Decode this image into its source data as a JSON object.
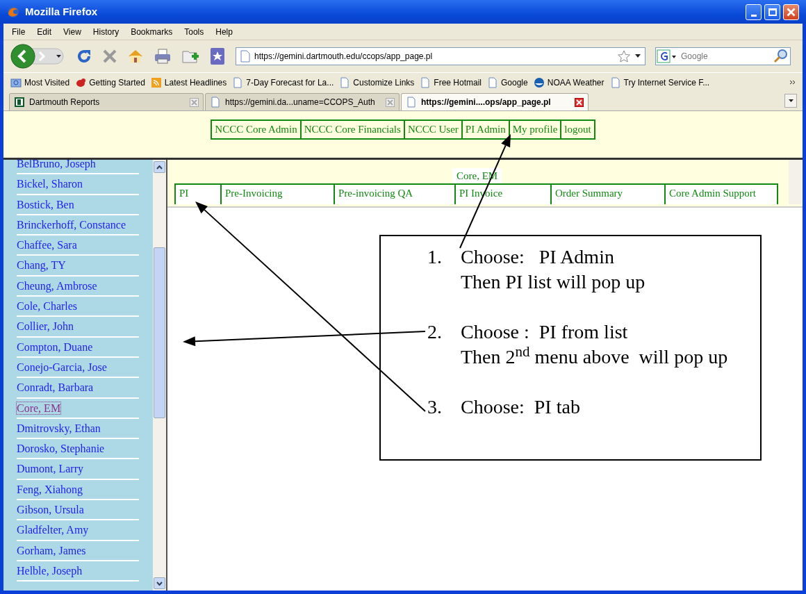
{
  "window": {
    "title": "Mozilla Firefox"
  },
  "menu": [
    "File",
    "Edit",
    "View",
    "History",
    "Bookmarks",
    "Tools",
    "Help"
  ],
  "address": {
    "value": "https://gemini.dartmouth.edu/ccops/app_page.pl"
  },
  "search": {
    "placeholder": "Google"
  },
  "bookmarks": [
    {
      "label": "Most Visited",
      "kind": "folder"
    },
    {
      "label": "Getting Started",
      "kind": "bug"
    },
    {
      "label": "Latest Headlines",
      "kind": "rss"
    },
    {
      "label": "7-Day Forecast for La...",
      "kind": "page"
    },
    {
      "label": "Customize Links",
      "kind": "page"
    },
    {
      "label": "Free Hotmail",
      "kind": "page"
    },
    {
      "label": "Google",
      "kind": "page"
    },
    {
      "label": "NOAA Weather",
      "kind": "globe"
    },
    {
      "label": "Try Internet Service F...",
      "kind": "page"
    }
  ],
  "tabs": [
    {
      "label": "Dartmouth Reports",
      "kind": "logo",
      "selected": false
    },
    {
      "label": "https://gemini.da...uname=CCOPS_Auth",
      "kind": "page",
      "selected": false
    },
    {
      "label": "https://gemini....ops/app_page.pl",
      "kind": "page",
      "selected": true
    }
  ],
  "top_menu": [
    "NCCC Core Admin",
    "NCCC Core Financials",
    "NCCC User",
    "PI Admin",
    "My profile",
    "logout"
  ],
  "pi_list": [
    {
      "name": "BelBruno, Joseph",
      "selected": false
    },
    {
      "name": "Bickel, Sharon",
      "selected": false
    },
    {
      "name": "Bostick, Ben",
      "selected": false
    },
    {
      "name": "Brinckerhoff, Constance",
      "selected": false
    },
    {
      "name": "Chaffee, Sara",
      "selected": false
    },
    {
      "name": "Chang, TY",
      "selected": false
    },
    {
      "name": "Cheung, Ambrose",
      "selected": false
    },
    {
      "name": "Cole, Charles",
      "selected": false
    },
    {
      "name": "Collier, John",
      "selected": false
    },
    {
      "name": "Compton, Duane",
      "selected": false
    },
    {
      "name": "Conejo-Garcia, Jose",
      "selected": false
    },
    {
      "name": "Conradt, Barbara",
      "selected": false
    },
    {
      "name": "Core, EM",
      "selected": true
    },
    {
      "name": "Dmitrovsky, Ethan",
      "selected": false
    },
    {
      "name": "Dorosko, Stephanie",
      "selected": false
    },
    {
      "name": "Dumont, Larry",
      "selected": false
    },
    {
      "name": "Feng, Xiahong",
      "selected": false
    },
    {
      "name": "Gibson, Ursula",
      "selected": false
    },
    {
      "name": "Gladfelter, Amy",
      "selected": false
    },
    {
      "name": "Gorham, James",
      "selected": false
    },
    {
      "name": "Helble, Joseph",
      "selected": false
    }
  ],
  "pi_heading": "Core, EM",
  "sub_tabs": [
    "PI",
    "Pre-Invoicing",
    "Pre-invoicing QA",
    "PI Invoice",
    "Order Summary",
    "Core Admin Support"
  ],
  "instructions": [
    {
      "number": "1.",
      "lines": [
        "Choose:   PI Admin",
        "Then PI list will pop up"
      ]
    },
    {
      "number": "2.",
      "lines": [
        "Choose :  PI from list",
        "Then 2$^{nd}$ menu above  will pop up"
      ]
    },
    {
      "number": "3.",
      "lines": [
        "Choose:  PI tab"
      ]
    }
  ]
}
